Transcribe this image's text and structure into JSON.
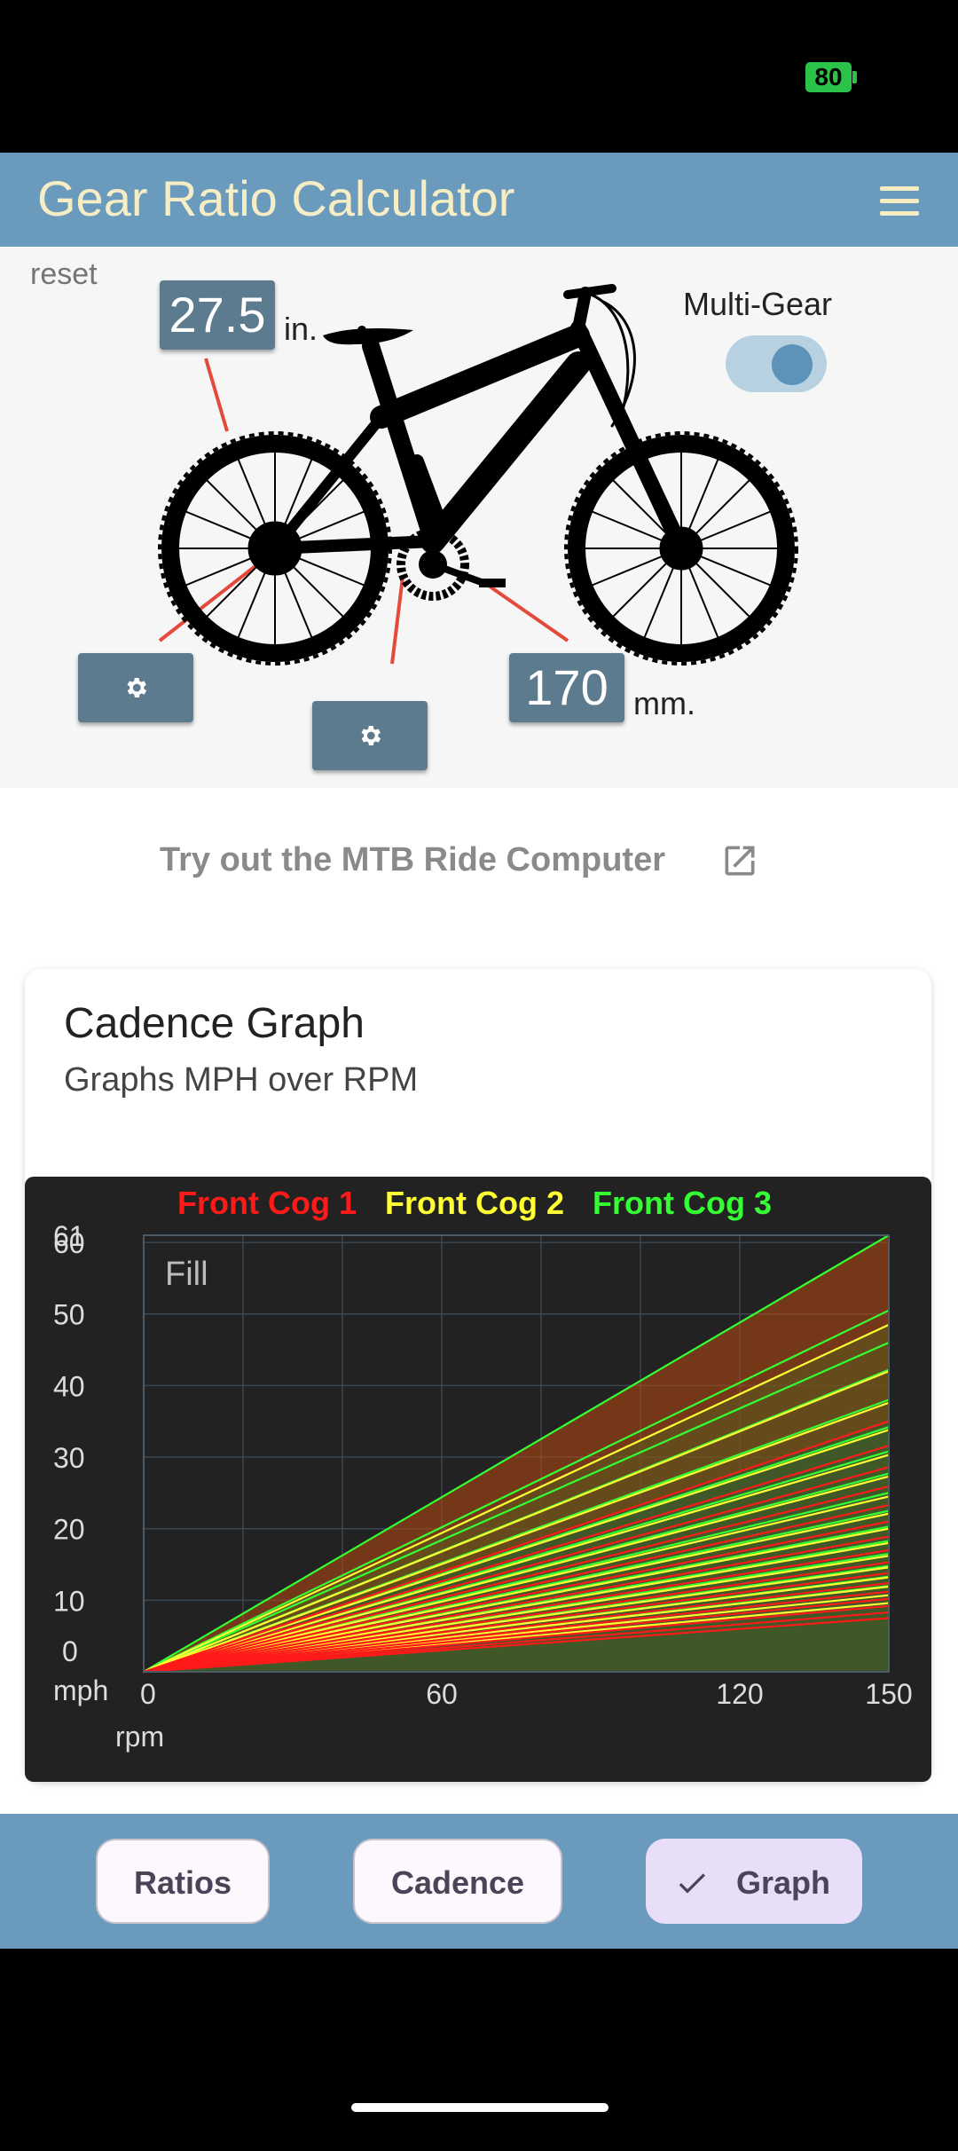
{
  "status": {
    "battery": "80"
  },
  "app": {
    "title": "Gear Ratio Calculator"
  },
  "bike": {
    "reset_label": "reset",
    "wheel_size": "27.5",
    "wheel_unit": "in.",
    "crank_length": "170",
    "crank_unit": "mm.",
    "multi_gear_label": "Multi-Gear",
    "multi_gear_on": true
  },
  "promo": {
    "text": "Try out the MTB Ride Computer"
  },
  "card": {
    "title": "Cadence Graph",
    "subtitle": "Graphs MPH over RPM"
  },
  "chart_data": {
    "type": "line",
    "fill_label": "Fill",
    "legend": [
      {
        "name": "Front Cog 1",
        "color": "#ff1a1a"
      },
      {
        "name": "Front Cog 2",
        "color": "#ffff33"
      },
      {
        "name": "Front Cog 3",
        "color": "#33ff33"
      }
    ],
    "xlabel": "rpm",
    "ylabel": "mph",
    "x_ticks": [
      0,
      60,
      120,
      150
    ],
    "y_ticks": [
      0,
      10,
      20,
      30,
      40,
      50,
      60,
      61
    ],
    "xlim": [
      0,
      150
    ],
    "ylim": [
      0,
      61
    ],
    "grid": true,
    "series": [
      {
        "color": "#ff1a1a",
        "values_at_150": [
          7.5,
          8.3,
          9.2,
          10.2,
          11.2,
          12.4,
          13.8,
          15.3,
          17.0,
          18.9,
          21.0,
          23.3,
          25.9,
          28.6,
          31.6,
          35.0
        ]
      },
      {
        "color": "#ffff33",
        "values_at_150": [
          9.6,
          10.7,
          11.9,
          13.2,
          14.6,
          16.2,
          18.0,
          20.0,
          22.1,
          24.5,
          27.3,
          30.3,
          33.8,
          37.6,
          42.0,
          48.5
        ]
      },
      {
        "color": "#33ff33",
        "values_at_150": [
          12.0,
          13.3,
          14.8,
          16.5,
          18.3,
          20.3,
          22.5,
          25.0,
          27.7,
          30.8,
          34.2,
          38.0,
          42.2,
          46.0,
          50.5,
          61.0
        ]
      }
    ]
  },
  "tabs": [
    {
      "label": "Ratios"
    },
    {
      "label": "Cadence"
    },
    {
      "label": "Graph",
      "selected": true
    }
  ]
}
